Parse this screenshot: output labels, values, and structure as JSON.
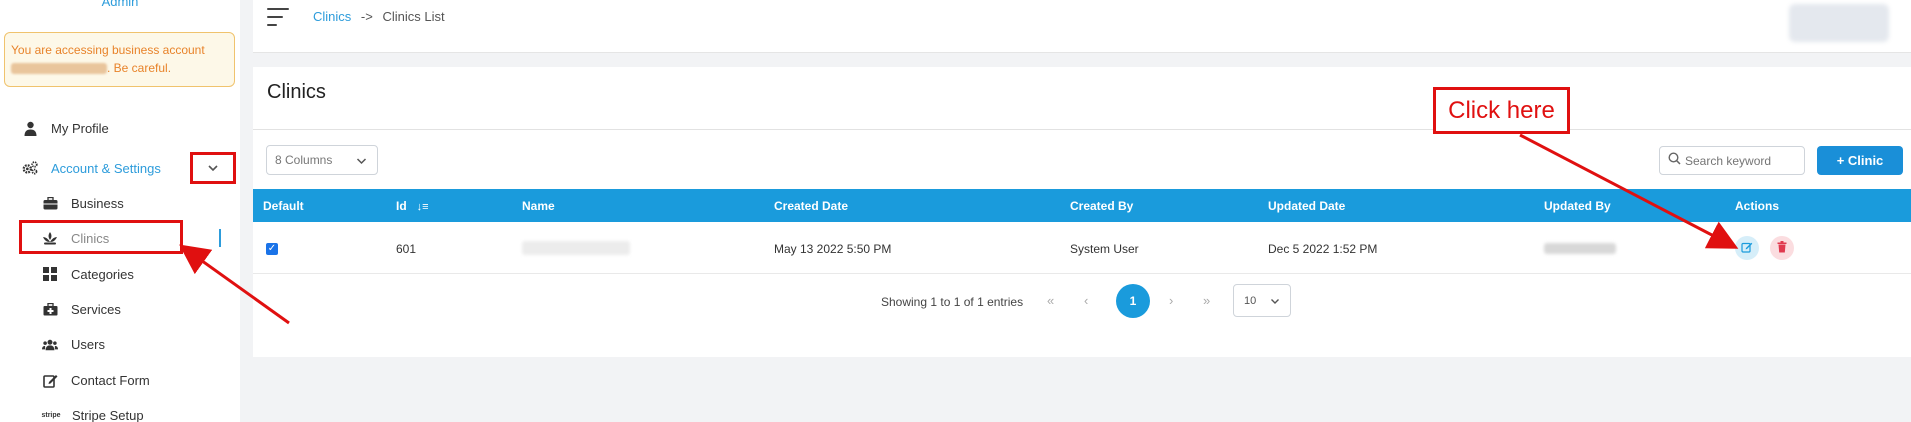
{
  "sidebar": {
    "admin_label": "Admin",
    "warning_text_1": "You are accessing business account",
    "warning_text_2": ". Be careful.",
    "items": [
      {
        "label": "My Profile",
        "icon": "user-icon"
      },
      {
        "label": "Account & Settings",
        "icon": "gears-icon"
      },
      {
        "label": "Business",
        "icon": "briefcase-icon"
      },
      {
        "label": "Clinics",
        "icon": "clinic-icon"
      },
      {
        "label": "Categories",
        "icon": "grid-icon"
      },
      {
        "label": "Services",
        "icon": "medkit-icon"
      },
      {
        "label": "Users",
        "icon": "users-icon"
      },
      {
        "label": "Contact Form",
        "icon": "edit-icon"
      },
      {
        "label": "Stripe Setup",
        "icon": "stripe-logo"
      }
    ],
    "stripe_logo_text": "stripe"
  },
  "header": {
    "breadcrumb_link": "Clinics",
    "breadcrumb_sep": "->",
    "breadcrumb_current": "Clinics List"
  },
  "main": {
    "title": "Clinics",
    "columns_select": "8 Columns",
    "search_placeholder": "Search keyword",
    "add_button": "+ Clinic",
    "table": {
      "headers": [
        "Default",
        "Id",
        "Name",
        "Created Date",
        "Created By",
        "Updated Date",
        "Updated By",
        "Actions"
      ],
      "rows": [
        {
          "default_checked": true,
          "id": "601",
          "created_date": "May 13 2022 5:50 PM",
          "created_by": "System User",
          "updated_date": "Dec 5 2022 1:52 PM"
        }
      ]
    },
    "pagination": {
      "info": "Showing 1 to 1 of 1 entries",
      "first": "«",
      "prev": "‹",
      "current": "1",
      "next": "›",
      "last": "»",
      "per_page": "10"
    }
  },
  "annotations": {
    "callout": "Click here",
    "color": "#e01010"
  },
  "colors": {
    "accent": "#1a9bdc",
    "warning_text": "#e8832a",
    "link": "#2d9cdb"
  }
}
